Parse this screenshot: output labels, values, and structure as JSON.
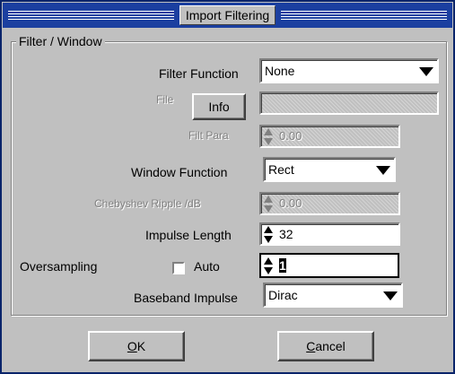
{
  "window": {
    "title": "Import Filtering"
  },
  "group": {
    "label": "Filter / Window"
  },
  "filter_function": {
    "label": "Filter Function",
    "value": "None"
  },
  "file": {
    "label": "File",
    "info_button": "Info"
  },
  "filt_para": {
    "label": "Filt Para",
    "value": "0.00"
  },
  "window_function": {
    "label": "Window Function",
    "value": "Rect"
  },
  "chebyshev": {
    "label": "Chebyshev Ripple /dB",
    "value": "0.00"
  },
  "impulse_length": {
    "label": "Impulse Length",
    "value": "32"
  },
  "oversampling": {
    "label": "Oversampling",
    "auto_label": "Auto",
    "auto_checked": false,
    "value": "1"
  },
  "baseband": {
    "label": "Baseband Impulse",
    "value": "Dirac"
  },
  "buttons": {
    "ok_mnemonic": "O",
    "ok_rest": "K",
    "cancel_mnemonic": "C",
    "cancel_rest": "ancel"
  }
}
